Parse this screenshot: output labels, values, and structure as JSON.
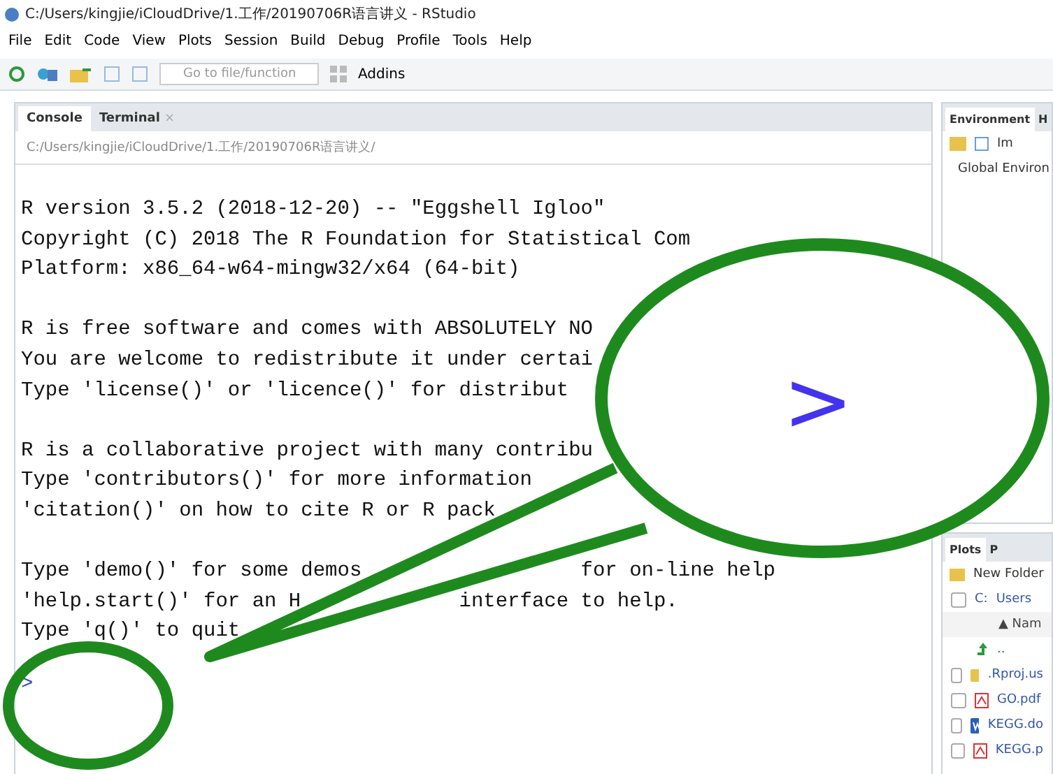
{
  "window": {
    "title": "C:/Users/kingjie/iCloudDrive/1.工作/20190706R语言讲义 - RStudio"
  },
  "menu": [
    "File",
    "Edit",
    "Code",
    "View",
    "Plots",
    "Session",
    "Build",
    "Debug",
    "Profile",
    "Tools",
    "Help"
  ],
  "toolbar": {
    "search_placeholder": "Go to file/function",
    "addins": "Addins"
  },
  "console_pane": {
    "tabs": [
      {
        "label": "Console",
        "selected": true
      },
      {
        "label": "Terminal",
        "selected": false,
        "close_mark": "×"
      }
    ],
    "path": "C:/Users/kingjie/iCloudDrive/1.工作/20190706R语言讲义/",
    "lines": [
      {
        "kind": "text",
        "parts": [
          "R version 3.5.2 (2018-12-20) -- \"Eggshell Igloo\""
        ]
      },
      {
        "kind": "text",
        "parts": [
          "Copyright (C) 2018 The R Foundation for Statistical Com"
        ]
      },
      {
        "kind": "text",
        "parts": [
          "Platform: x86_64-w64-mingw32/x64 (64-bit)"
        ]
      },
      {
        "kind": "blank"
      },
      {
        "kind": "text",
        "parts": [
          "R is free software and comes with ABSOLUTELY NO"
        ]
      },
      {
        "kind": "text",
        "parts": [
          "You are welcome to redistribute it under certai"
        ]
      },
      {
        "kind": "text",
        "parts": [
          "Type 'license()' or 'licence()' for distribut"
        ]
      },
      {
        "kind": "blank"
      },
      {
        "kind": "text",
        "parts": [
          "R is a collaborative project with many contribu"
        ]
      },
      {
        "kind": "text",
        "parts": [
          "Type 'contributors()' for more information"
        ]
      },
      {
        "kind": "text",
        "parts": [
          "'citation()' on how to cite R or R pack"
        ]
      },
      {
        "kind": "blank"
      },
      {
        "kind": "text",
        "parts": [
          "Type 'demo()' for some demos",
          "for on-line help"
        ]
      },
      {
        "kind": "text",
        "parts": [
          "'help.start()' for an H",
          "interface to help."
        ]
      },
      {
        "kind": "text",
        "parts": [
          "Type 'q()' to quit"
        ]
      }
    ],
    "prompt": ">"
  },
  "env_pane": {
    "tabs": [
      {
        "label": "Environment",
        "selected": true
      },
      {
        "label": "H",
        "selected": false
      }
    ],
    "import_label": "Im",
    "scope": "Global Environ"
  },
  "files_pane": {
    "tabs": [
      {
        "label": "Plots",
        "selected": true
      },
      {
        "label": "P",
        "selected": false
      }
    ],
    "new_folder": "New Folder",
    "select_all_checked": false,
    "crumbs": [
      "C:",
      "Users"
    ],
    "name_header": "▲ Nam",
    "rows": [
      {
        "kind": "up",
        "name": ".."
      },
      {
        "kind": "folder",
        "name": ".Rproj.us",
        "checked": false
      },
      {
        "kind": "pdf",
        "name": "GO.pdf",
        "checked": false
      },
      {
        "kind": "word",
        "name": "KEGG.do",
        "checked": false
      },
      {
        "kind": "pdf",
        "name": "KEGG.p",
        "checked": false
      }
    ]
  },
  "callout": {
    "text": ">"
  }
}
